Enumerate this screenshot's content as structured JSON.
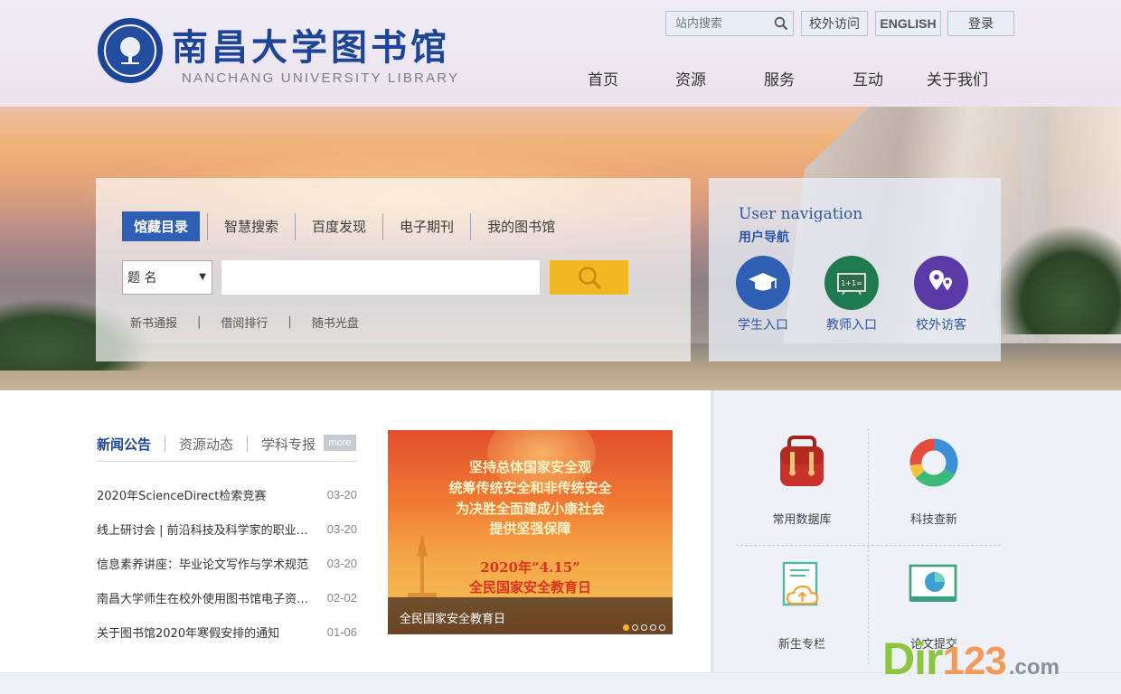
{
  "header": {
    "title_cn": "南昌大学图书馆",
    "subtitle_en": "NANCHANG UNIVERSITY  LIBRARY",
    "search_placeholder": "站内搜索",
    "offcampus_label": "校外访问",
    "english_label": "ENGLISH",
    "login_label": "登录",
    "nav": [
      "首页",
      "资源",
      "服务",
      "互动",
      "关于我们"
    ]
  },
  "search": {
    "tabs": [
      "馆藏目录",
      "智慧搜索",
      "百度发现",
      "电子期刊",
      "我的图书馆"
    ],
    "active_tab": 0,
    "field_select_value": "题 名",
    "query_value": "",
    "quick_links": [
      "新书通报",
      "借阅排行",
      "随书光盘"
    ]
  },
  "user_nav": {
    "title_en": "User navigation",
    "title_cn": "用户导航",
    "items": [
      {
        "label": "学生入口",
        "color": "#2f5fb5",
        "icon": "graduation-cap-icon"
      },
      {
        "label": "教师入口",
        "color": "#1f7a4f",
        "icon": "blackboard-icon"
      },
      {
        "label": "校外访客",
        "color": "#5b3aa8",
        "icon": "map-pins-icon"
      }
    ]
  },
  "news": {
    "tabs": [
      "新闻公告",
      "资源动态",
      "学科专报"
    ],
    "more_label": "more",
    "items": [
      {
        "title": "2020年ScienceDirect检索竞赛",
        "date": "03-20"
      },
      {
        "title": "线上研讨会 | 前沿科技及科学家的职业发展",
        "date": "03-20"
      },
      {
        "title": "信息素养讲座：毕业论文写作与学术规范",
        "date": "03-20"
      },
      {
        "title": "南昌大学师生在校外使用图书馆电子资源的方法",
        "date": "02-02"
      },
      {
        "title": "关于图书馆2020年寒假安排的通知",
        "date": "01-06"
      }
    ]
  },
  "banner": {
    "lines": [
      "坚持总体国家安全观",
      "统筹传统安全和非传统安全",
      "为决胜全面建成小康社会",
      "提供坚强保障",
      "2020年“4.15”",
      "全民国家安全教育日"
    ],
    "caption": "全民国家安全教育日",
    "slide_count": 5,
    "active_slide": 0
  },
  "services": [
    {
      "label": "常用数据库",
      "icon": "backpack-icon"
    },
    {
      "label": "科技查新",
      "icon": "donut-chart-icon"
    },
    {
      "label": "新生专栏",
      "icon": "cloud-upload-document-icon"
    },
    {
      "label": "论文提交",
      "icon": "pie-chart-book-icon"
    }
  ],
  "watermark": {
    "part1": "Dir",
    "part2": "123",
    "part3": ".com"
  },
  "colors": {
    "brand_blue": "#1d4597",
    "search_yellow": "#f2b824",
    "tab_active": "#2f5fb5"
  }
}
